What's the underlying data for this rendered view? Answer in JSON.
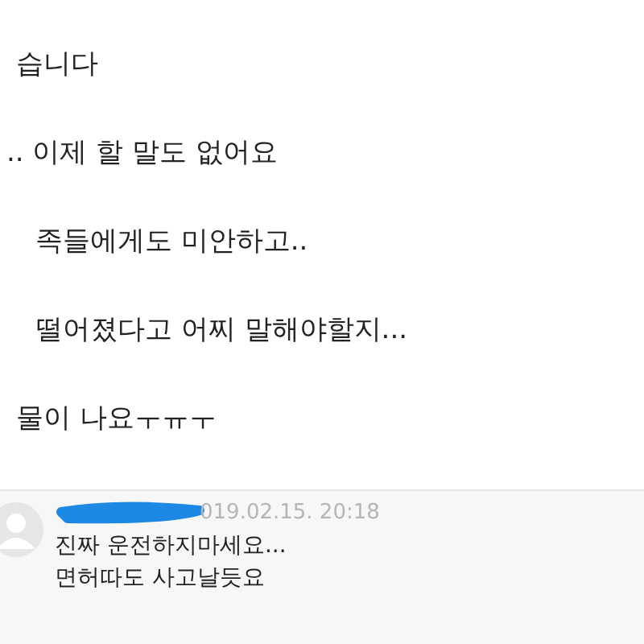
{
  "post": {
    "lines": [
      "습니다",
      ".. 이제 할 말도 없어요",
      "족들에게도 미안하고..",
      "떨어졌다고 어찌 말해야할지...",
      "물이 나요ㅜㅠㅜ"
    ]
  },
  "comment": {
    "date": "019.02.15. 20:18",
    "lines": [
      "진짜 운전하지마세요...",
      "면허따도 사고날듯요"
    ]
  }
}
